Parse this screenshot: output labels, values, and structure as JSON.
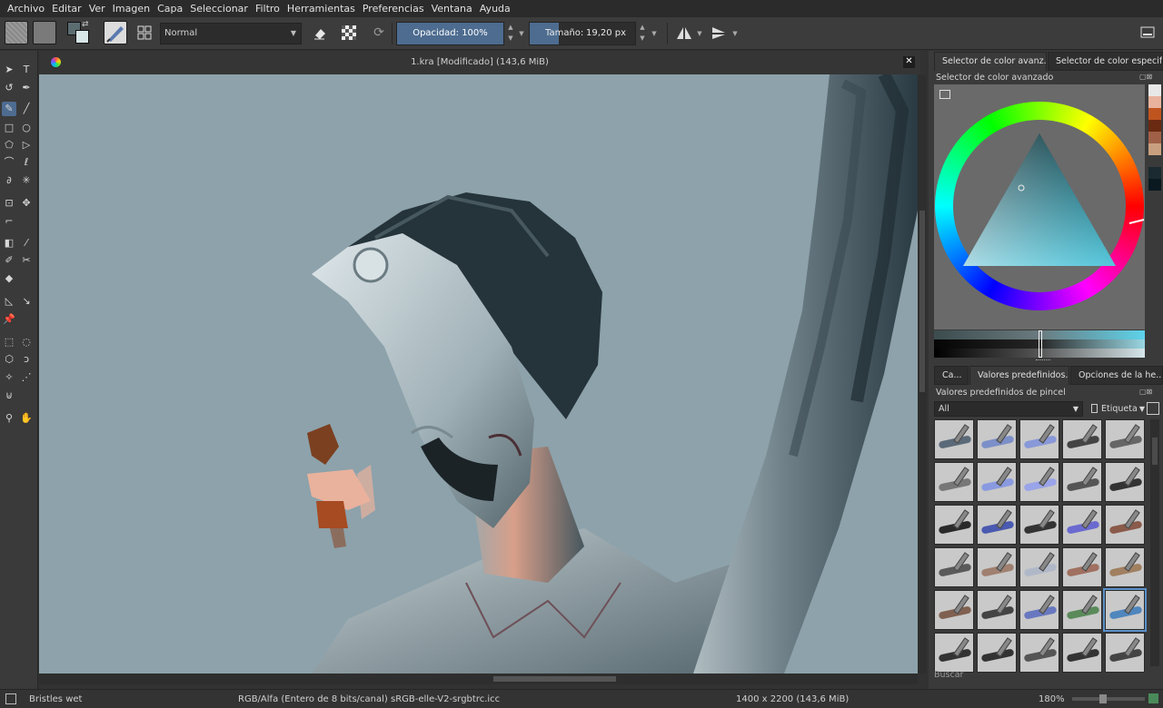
{
  "menu": [
    "Archivo",
    "Editar",
    "Ver",
    "Imagen",
    "Capa",
    "Seleccionar",
    "Filtro",
    "Herramientas",
    "Preferencias",
    "Ventana",
    "Ayuda"
  ],
  "toolbar": {
    "blend_mode": "Normal",
    "opacity_text": "Opacidad:  100%",
    "opacity_value": 1.0,
    "size_label": "Tamaño:",
    "size_value": "19,20 px"
  },
  "document": {
    "title": "1.kra [Modificado]   (143,6 MiB)"
  },
  "status": {
    "brush": "Bristles wet",
    "color_space": "RGB/Alfa (Entero de 8 bits/canal)  sRGB-elle-V2-srgbtrc.icc",
    "dimensions": "1400 x 2200 (143,6 MiB)",
    "zoom": "180%"
  },
  "dock": {
    "top_tabs": [
      "Selector de color avanz...",
      "Selector de color especif..."
    ],
    "color_panel_title": "Selector de color avanzado",
    "bottom_tabs": [
      "Ca...",
      "Valores predefinidos...",
      "Opciones de la he..."
    ],
    "presets_title": "Valores predefinidos de pincel",
    "filter_value": "All",
    "tag_label": "Etiqueta",
    "search_placeholder": "Buscar"
  },
  "colors": {
    "accent": "#4d6c90",
    "canvas_bg": "#8da2ab",
    "history_swatches": [
      "#e8e8e8",
      "#e9b29d",
      "#c0541f",
      "#6a2a12",
      "#a06048",
      "#c8a080",
      "#3a3a3a",
      "#1a2a30",
      "#0a1820"
    ]
  }
}
